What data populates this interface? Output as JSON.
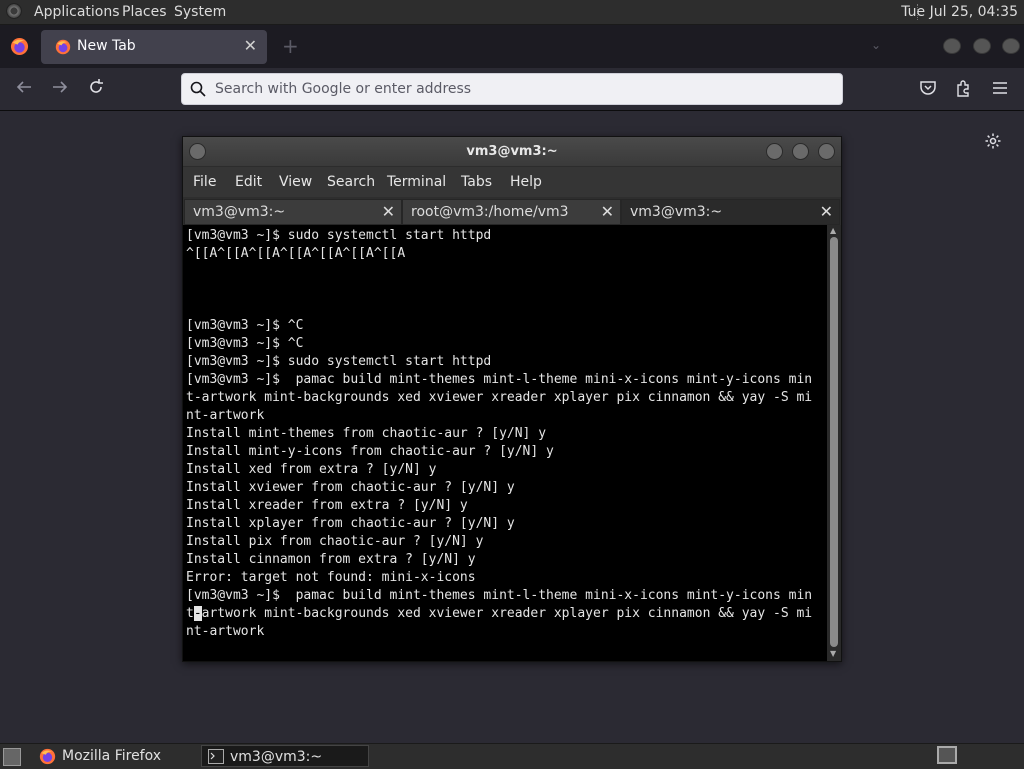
{
  "top_panel": {
    "menus": [
      "Applications",
      "Places",
      "System"
    ],
    "clock": "Tue Jul 25, 04:35"
  },
  "firefox": {
    "tab_title": "New Tab",
    "url_placeholder": "Search with Google or enter address",
    "icons": {
      "back": "arrow-left-icon",
      "forward": "arrow-right-icon",
      "reload": "reload-icon",
      "pocket": "pocket-icon",
      "extensions": "puzzle-icon",
      "menu": "hamburger-icon",
      "settings": "gear-icon"
    }
  },
  "terminal": {
    "title": "vm3@vm3:~",
    "menu": [
      "File",
      "Edit",
      "View",
      "Search",
      "Terminal",
      "Tabs",
      "Help"
    ],
    "tabs": [
      {
        "label": "vm3@vm3:~",
        "active": false
      },
      {
        "label": "root@vm3:/home/vm3",
        "active": false
      },
      {
        "label": "vm3@vm3:~",
        "active": true
      }
    ],
    "lines": [
      "[vm3@vm3 ~]$ sudo systemctl start httpd",
      "^[[A^[[A^[[A^[[A^[[A^[[A^[[A",
      "",
      "",
      "",
      "[vm3@vm3 ~]$ ^C",
      "[vm3@vm3 ~]$ ^C",
      "[vm3@vm3 ~]$ sudo systemctl start httpd",
      "[vm3@vm3 ~]$  pamac build mint-themes mint-l-theme mini-x-icons mint-y-icons min",
      "t-artwork mint-backgrounds xed xviewer xreader xplayer pix cinnamon && yay -S mi",
      "nt-artwork",
      "Install mint-themes from chaotic-aur ? [y/N] y",
      "Install mint-y-icons from chaotic-aur ? [y/N] y",
      "Install xed from extra ? [y/N] y",
      "Install xviewer from chaotic-aur ? [y/N] y",
      "Install xreader from extra ? [y/N] y",
      "Install xplayer from chaotic-aur ? [y/N] y",
      "Install pix from chaotic-aur ? [y/N] y",
      "Install cinnamon from extra ? [y/N] y",
      "Error: target not found: mini-x-icons",
      "[vm3@vm3 ~]$  pamac build mint-themes mint-l-theme mini-x-icons mint-y-icons min"
    ],
    "cursor_line": {
      "before": "t",
      "cursor": "-",
      "after": "artwork mint-backgrounds xed xviewer xreader xplayer pix cinnamon && yay -S mi"
    },
    "last_line": "nt-artwork"
  },
  "taskbar": {
    "tasks": [
      {
        "label": "Mozilla Firefox",
        "icon": "firefox-icon"
      },
      {
        "label": "vm3@vm3:~",
        "icon": "terminal-icon"
      }
    ]
  },
  "colors": {
    "firefox_bg": "#2b2a33",
    "panel_bg": "#2d2d2d",
    "terminal_bg": "#000000"
  }
}
